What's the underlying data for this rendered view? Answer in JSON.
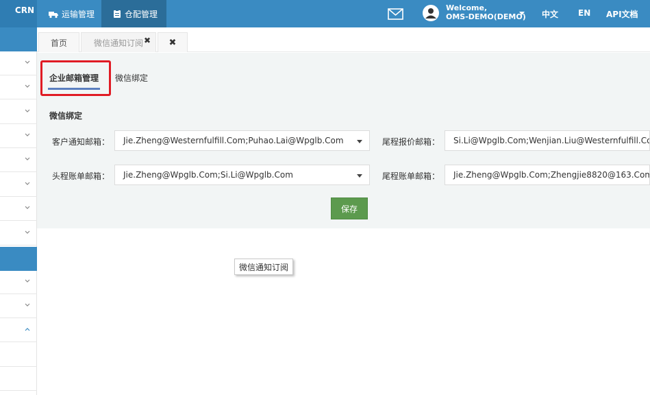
{
  "header": {
    "brand_fragment": "CRN",
    "nav": [
      {
        "label": "运输管理",
        "icon": "truck-icon"
      },
      {
        "label": "仓配管理",
        "icon": "clipboard-icon"
      }
    ],
    "welcome_line1": "Welcome,",
    "welcome_line2": "OMS-DEMO(DEMO)",
    "lang_zh": "中文",
    "lang_en": "EN",
    "api_docs": "API文档"
  },
  "tabs": {
    "home": "首页",
    "wechat": "微信通知订阅",
    "close_symbol": "✖"
  },
  "subtabs": {
    "email_mgmt": "企业邮箱管理",
    "wechat_bind": "微信绑定"
  },
  "form": {
    "section_title": "微信绑定",
    "fields": [
      {
        "label": "客户通知邮箱：",
        "value": "Jie.Zheng@Westernfulfill.Com;Puhao.Lai@Wpglb.Com"
      },
      {
        "label": "尾程报价邮箱：",
        "value": "Si.Li@Wpglb.Com;Wenjian.Liu@Westernfulfill.Com"
      },
      {
        "label": "头程账单邮箱：",
        "value": "Jie.Zheng@Wpglb.Com;Si.Li@Wpglb.Com"
      },
      {
        "label": "尾程账单邮箱：",
        "value": "Jie.Zheng@Wpglb.Com;Zhengjie8820@163.Com"
      }
    ],
    "save_label": "保存"
  },
  "tooltip": "微信通知订阅",
  "colors": {
    "topbar": "#3a8bc2",
    "active_nav": "#2b6d99",
    "save": "#5c9a4e",
    "highlight": "#e01b24"
  }
}
